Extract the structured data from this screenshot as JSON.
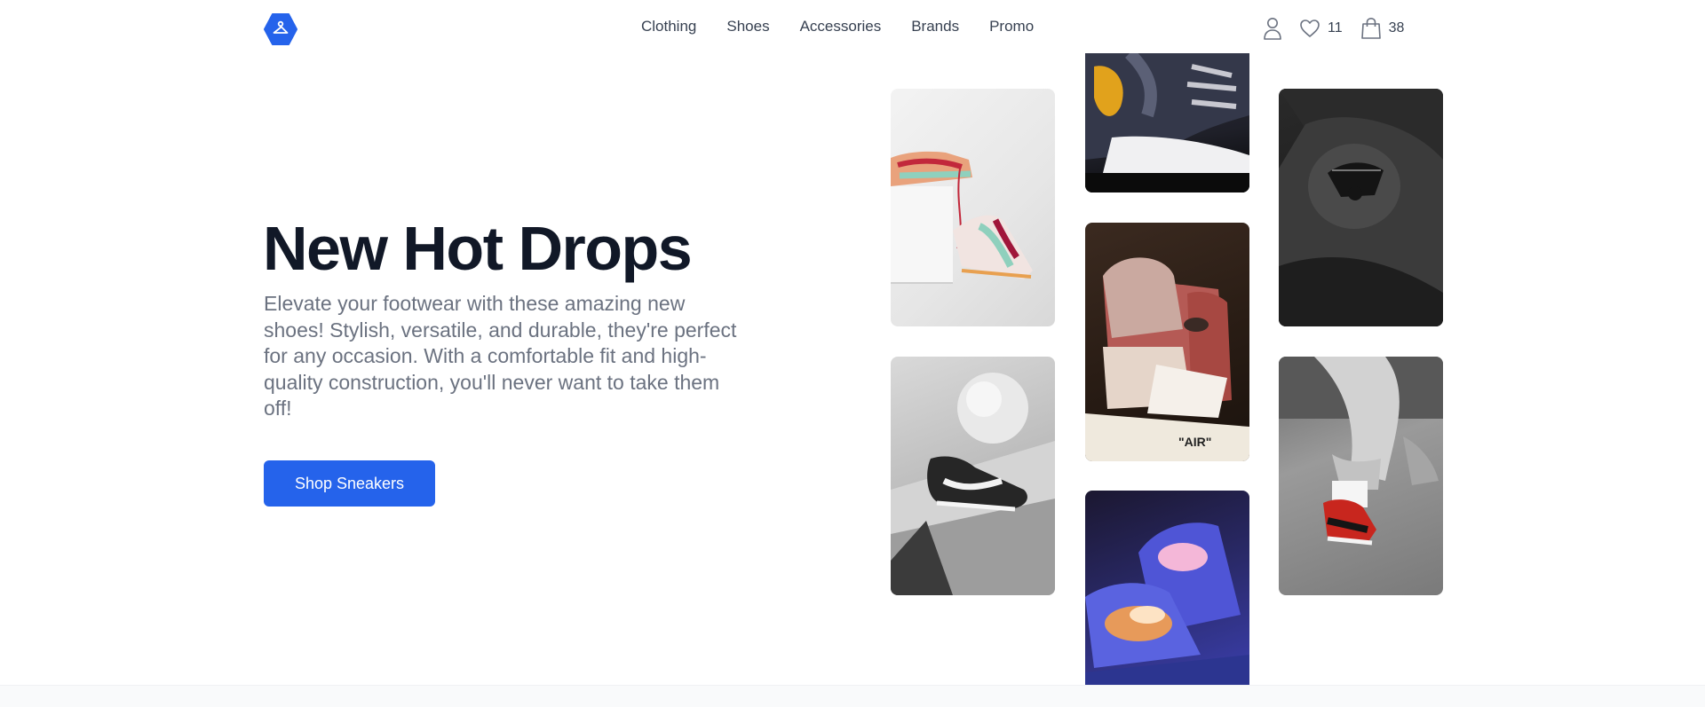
{
  "header": {
    "logo_icon": "hanger-hexagon-icon",
    "nav": [
      {
        "label": "Clothing"
      },
      {
        "label": "Shoes"
      },
      {
        "label": "Accessories"
      },
      {
        "label": "Brands"
      },
      {
        "label": "Promo"
      }
    ],
    "account_icon": "user-icon",
    "wishlist_icon": "heart-icon",
    "wishlist_count": "11",
    "cart_icon": "shopping-bag-icon",
    "cart_count": "38"
  },
  "hero": {
    "title": "New Hot Drops",
    "description": "Elevate your footwear with these amazing new shoes! Stylish, versatile, and durable, they're perfect for any occasion. With a comfortable fit and high-quality construction, you'll never want to take them off!",
    "cta_label": "Shop Sneakers"
  },
  "gallery": {
    "tiles": [
      {
        "subject": "colorful sneakers on white box"
      },
      {
        "subject": "black sneaker with sphere"
      },
      {
        "subject": "navy and yellow sneaker close-up"
      },
      {
        "subject": "red high-top AIR sneaker"
      },
      {
        "subject": "glowing blue sneaker"
      },
      {
        "subject": "dark sneaker wings logo"
      },
      {
        "subject": "person wearing red sneakers"
      }
    ]
  },
  "colors": {
    "accent": "#2563eb",
    "title": "#111827",
    "body_text": "#6b7280",
    "nav_text": "#374151"
  }
}
